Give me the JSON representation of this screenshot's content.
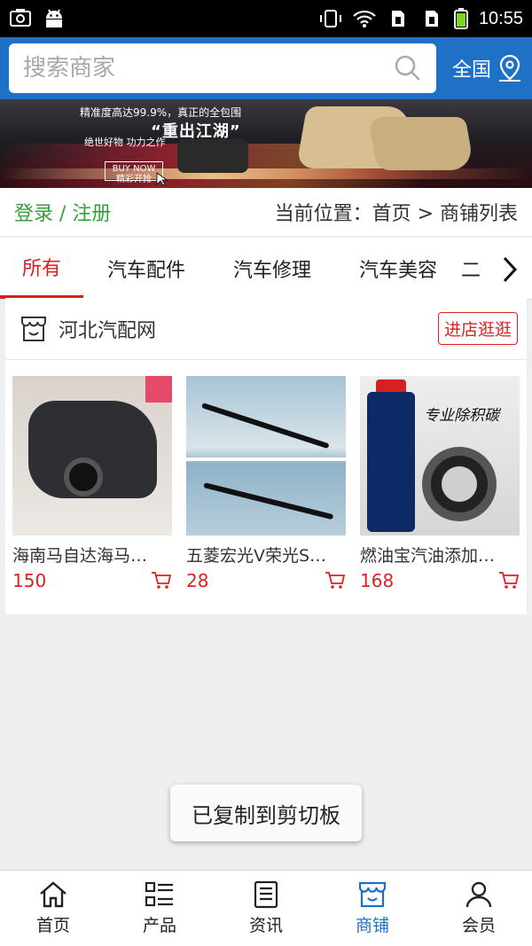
{
  "status_bar": {
    "time": "10:55"
  },
  "search": {
    "placeholder": "搜索商家",
    "region_label": "全国"
  },
  "banner": {
    "line1": "精准度高达99.9%，真正的全包围",
    "title": "“重出江湖”",
    "line2": "绝世好物 功力之作",
    "cta_top": "BUY NOW",
    "cta_bottom": "精彩开抢"
  },
  "breadcrumb": {
    "login": "登录 / 注册",
    "position": "当前位置：首页 > 商铺列表"
  },
  "tabs": [
    {
      "label": "所有"
    },
    {
      "label": "汽车配件"
    },
    {
      "label": "汽车修理"
    },
    {
      "label": "汽车美容"
    },
    {
      "label": "二"
    }
  ],
  "shop": {
    "name": "河北汽配网",
    "enter_label": "进店逛逛",
    "products": [
      {
        "name": "海南马自达海马…",
        "price": "150"
      },
      {
        "name": "五菱宏光V荣光S…",
        "price": "28"
      },
      {
        "name": "燃油宝汽油添加…",
        "price": "168"
      }
    ],
    "product3_banner_text": "专业除积碳"
  },
  "toast": {
    "text": "已复制到剪切板"
  },
  "bottom_nav": [
    {
      "label": "首页",
      "icon": "home-icon"
    },
    {
      "label": "产品",
      "icon": "list-icon"
    },
    {
      "label": "资讯",
      "icon": "news-icon"
    },
    {
      "label": "商铺",
      "icon": "store-icon"
    },
    {
      "label": "会员",
      "icon": "user-icon"
    }
  ],
  "colors": {
    "primary": "#1e71c5",
    "accent": "#d62020",
    "login": "#34a03d"
  }
}
